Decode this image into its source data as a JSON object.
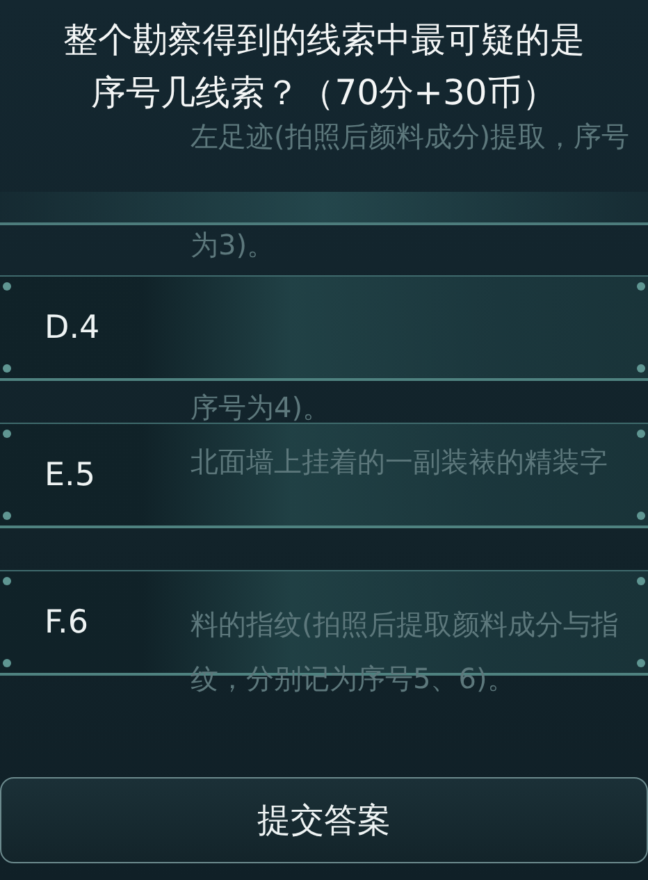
{
  "question": {
    "line_1": "整个勘察得到的线索中最可疑的是",
    "line_2": "序号几线索？（70分+30币）"
  },
  "background_text": [
    "左足迹(拍照后颜料成分)提取，序号",
    "为3)。",
    "序号为4)。",
    "北面墙上挂着的一副装裱的精装字",
    "料的指纹(拍照后提取颜料成分与指",
    "纹，分别记为序号5、6)。"
  ],
  "options": [
    {
      "label": "D.4",
      "selected": false
    },
    {
      "label": "E.5",
      "selected": false
    },
    {
      "label": "F.6",
      "selected": false
    }
  ],
  "submit_button": "提交答案"
}
